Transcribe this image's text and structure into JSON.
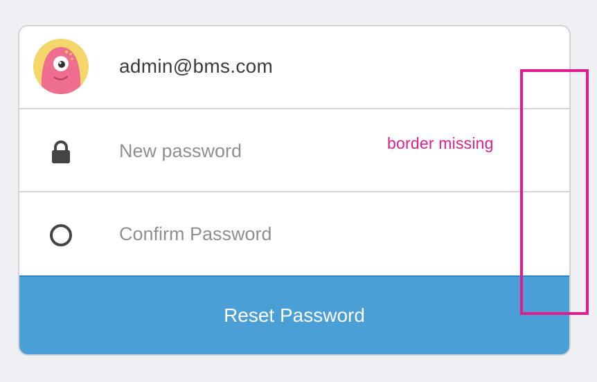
{
  "account": {
    "email": "admin@bms.com",
    "avatar_icon": "pink-monster-avatar"
  },
  "form": {
    "new_password_placeholder": "New password",
    "new_password_icon": "lock-icon",
    "confirm_password_placeholder": "Confirm Password",
    "confirm_password_icon": "circle-icon",
    "submit_label": "Reset Password"
  },
  "annotation": {
    "note": "border missing",
    "color": "#e31c8d"
  },
  "colors": {
    "button": "#4aa0d6",
    "avatar_bg": "#f5d66b",
    "avatar_face": "#ef6e8f"
  }
}
